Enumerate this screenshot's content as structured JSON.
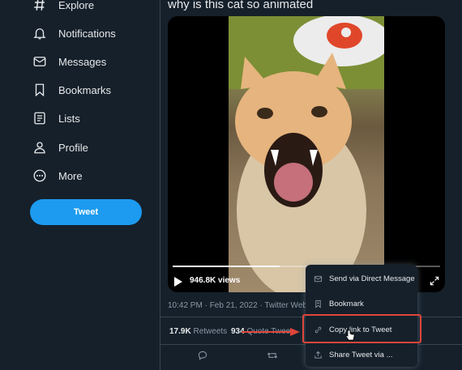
{
  "sidebar": {
    "items": [
      {
        "label": "Explore",
        "icon": "hashtag-icon"
      },
      {
        "label": "Notifications",
        "icon": "bell-icon"
      },
      {
        "label": "Messages",
        "icon": "envelope-icon"
      },
      {
        "label": "Bookmarks",
        "icon": "bookmark-icon"
      },
      {
        "label": "Lists",
        "icon": "list-icon"
      },
      {
        "label": "Profile",
        "icon": "person-icon"
      },
      {
        "label": "More",
        "icon": "more-circle-icon"
      }
    ],
    "tweet_button": "Tweet"
  },
  "tweet": {
    "text": "why is this cat so animated",
    "video": {
      "views": "946.8K views",
      "progress": 0.4
    },
    "meta": "10:42 PM · Feb 21, 2022 · Twitter Web Ap",
    "retweets": {
      "count": "17.9K",
      "label": "Retweets"
    },
    "quote_tweets": {
      "count": "934",
      "label": "Quote Twee"
    }
  },
  "share_menu": {
    "items": [
      {
        "label": "Send via Direct Message",
        "icon": "envelope-icon"
      },
      {
        "label": "Bookmark",
        "icon": "bookmark-add-icon"
      },
      {
        "label": "Copy link to Tweet",
        "icon": "link-icon"
      },
      {
        "label": "Share Tweet via ...",
        "icon": "share-icon"
      }
    ],
    "highlighted_index": 2
  },
  "colors": {
    "accent": "#1d9bf0",
    "background": "#15202b",
    "highlight": "#e0453a"
  }
}
